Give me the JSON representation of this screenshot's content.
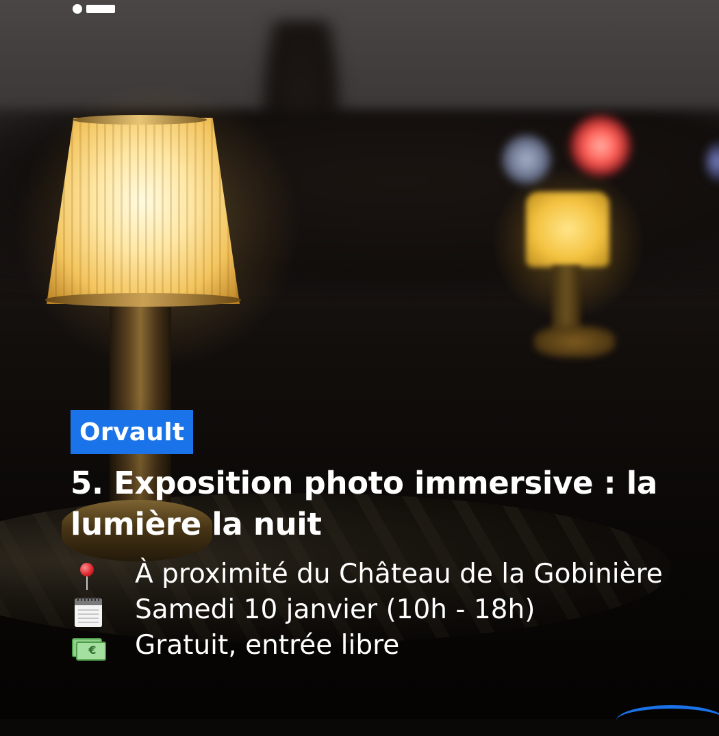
{
  "brand": {
    "logo_icon": "brand-logo-icon"
  },
  "post": {
    "location_tag": "Orvault",
    "title": "5. Exposition photo immersive : la lumière la nuit",
    "details": [
      {
        "icon": "round-pushpin-icon",
        "text": "À proximité du Château de la Gobinière"
      },
      {
        "icon": "calendar-icon",
        "text": "Samedi 10 janvier (10h - 18h)"
      },
      {
        "icon": "euro-banknote-icon",
        "text": "Gratuit, entrée libre"
      }
    ]
  },
  "colors": {
    "tag_background": "#1a73e8",
    "text": "#ffffff"
  }
}
